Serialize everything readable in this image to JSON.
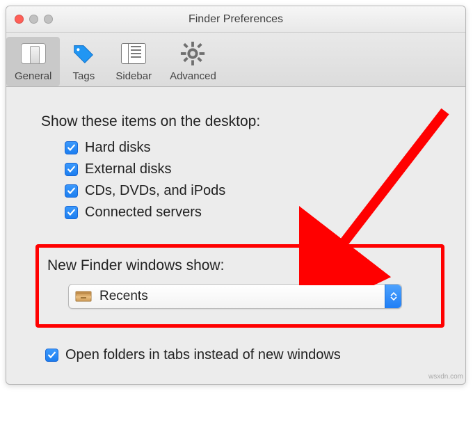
{
  "window": {
    "title": "Finder Preferences"
  },
  "toolbar": {
    "general": "General",
    "tags": "Tags",
    "sidebar": "Sidebar",
    "advanced": "Advanced"
  },
  "desktopSection": {
    "heading": "Show these items on the desktop:",
    "items": [
      {
        "label": "Hard disks"
      },
      {
        "label": "External disks"
      },
      {
        "label": "CDs, DVDs, and iPods"
      },
      {
        "label": "Connected servers"
      }
    ]
  },
  "newWindowSection": {
    "heading": "New Finder windows show:",
    "selected": "Recents"
  },
  "tabsOption": {
    "label": "Open folders in tabs instead of new windows"
  },
  "watermark": "wsxdn.com",
  "colors": {
    "accent": "#1f7ef6",
    "highlight": "#ff0000"
  }
}
